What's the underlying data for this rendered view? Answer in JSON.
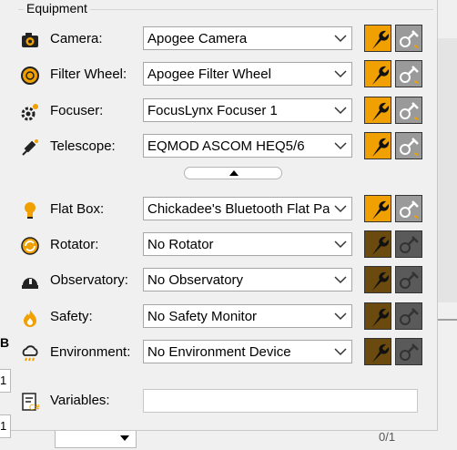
{
  "group": {
    "title": "Equipment"
  },
  "equipment": [
    {
      "key": "camera",
      "label": "Camera:",
      "value": "Apogee Camera",
      "state": "active"
    },
    {
      "key": "filter-wheel",
      "label": "Filter Wheel:",
      "value": "Apogee Filter Wheel",
      "state": "active"
    },
    {
      "key": "focuser",
      "label": "Focuser:",
      "value": "FocusLynx Focuser 1",
      "state": "active"
    },
    {
      "key": "telescope",
      "label": "Telescope:",
      "value": "EQMOD ASCOM HEQ5/6",
      "state": "active"
    },
    {
      "key": "flat-box",
      "label": "Flat Box:",
      "value": "Chickadee's Bluetooth Flat Panel",
      "state": "active"
    },
    {
      "key": "rotator",
      "label": "Rotator:",
      "value": "No Rotator",
      "state": "disabled"
    },
    {
      "key": "observatory",
      "label": "Observatory:",
      "value": "No Observatory",
      "state": "disabled"
    },
    {
      "key": "safety",
      "label": "Safety:",
      "value": "No Safety Monitor",
      "state": "disabled"
    },
    {
      "key": "environment",
      "label": "Environment:",
      "value": "No Environment Device",
      "state": "disabled"
    }
  ],
  "variables": {
    "label": "Variables:",
    "value": ""
  },
  "background": {
    "left_cells": [
      "1",
      "1"
    ],
    "bottom_text": "0/1",
    "left_letter": "B"
  },
  "colors": {
    "setup_active": "#f0a000",
    "setup_disabled": "#6b4a10",
    "connect_active": "#9a9a9a",
    "connect_disabled": "#5a5a5a"
  }
}
